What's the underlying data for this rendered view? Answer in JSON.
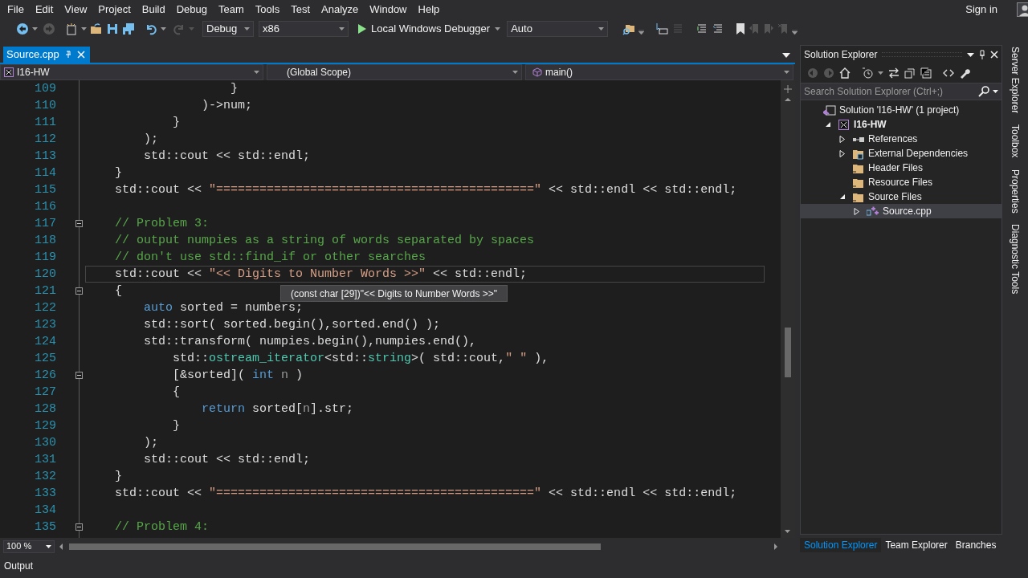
{
  "menu": [
    "File",
    "Edit",
    "View",
    "Project",
    "Build",
    "Debug",
    "Team",
    "Tools",
    "Test",
    "Analyze",
    "Window",
    "Help"
  ],
  "sign_in": "Sign in",
  "toolbar": {
    "configuration": "Debug",
    "platform": "x86",
    "debugger": "Local Windows Debugger",
    "option": "Auto"
  },
  "document_tabs": [
    {
      "title": "Source.cpp",
      "selected": true
    }
  ],
  "nav_bar": {
    "project": "I16-HW",
    "scope": "(Global Scope)",
    "member": "main()"
  },
  "editor": {
    "lines": [
      {
        "n": "109",
        "current": false,
        "fold": false,
        "tokens": [
          {
            "kind": "plain",
            "text": "                    }"
          }
        ]
      },
      {
        "n": "110",
        "current": false,
        "fold": false,
        "tokens": [
          {
            "kind": "plain",
            "text": "                )->num;"
          }
        ]
      },
      {
        "n": "111",
        "current": false,
        "fold": false,
        "tokens": [
          {
            "kind": "plain",
            "text": "            }"
          }
        ]
      },
      {
        "n": "112",
        "current": false,
        "fold": false,
        "tokens": [
          {
            "kind": "plain",
            "text": "        );"
          }
        ]
      },
      {
        "n": "113",
        "current": false,
        "fold": false,
        "tokens": [
          {
            "kind": "plain",
            "text": "        std::cout << std::endl;"
          }
        ]
      },
      {
        "n": "114",
        "current": false,
        "fold": false,
        "tokens": [
          {
            "kind": "plain",
            "text": "    }"
          }
        ]
      },
      {
        "n": "115",
        "current": false,
        "fold": false,
        "tokens": [
          {
            "kind": "plain",
            "text": "    std::cout << "
          },
          {
            "kind": "string",
            "text": "\"============================================\""
          },
          {
            "kind": "plain",
            "text": " << std::endl << std::endl;"
          }
        ]
      },
      {
        "n": "116",
        "current": false,
        "fold": false
      },
      {
        "n": "117",
        "current": false,
        "fold": true,
        "tokens": [
          {
            "kind": "comment",
            "text": "    // Problem 3:"
          }
        ]
      },
      {
        "n": "118",
        "current": false,
        "fold": false,
        "tokens": [
          {
            "kind": "comment",
            "text": "    // output numpies as a string of words separated by spaces"
          }
        ]
      },
      {
        "n": "119",
        "current": false,
        "fold": false,
        "tokens": [
          {
            "kind": "comment",
            "text": "    // don't use std::find_if or other searches"
          }
        ]
      },
      {
        "n": "120",
        "current": true,
        "fold": false,
        "tokens": [
          {
            "kind": "plain",
            "text": "    std::cout << "
          },
          {
            "kind": "string",
            "text": "\"<< Digits to Number Words >>\""
          },
          {
            "kind": "plain",
            "text": " << std::endl;"
          }
        ]
      },
      {
        "n": "121",
        "current": false,
        "fold": true,
        "tokens": [
          {
            "kind": "plain",
            "text": "    {"
          }
        ]
      },
      {
        "n": "122",
        "current": false,
        "fold": false,
        "tokens": [
          {
            "kind": "keyword",
            "text": "        auto"
          },
          {
            "kind": "plain",
            "text": " sorted = numbers;"
          }
        ]
      },
      {
        "n": "123",
        "current": false,
        "fold": false,
        "tokens": [
          {
            "kind": "plain",
            "text": "        std::sort( sorted.begin(),sorted.end() );"
          }
        ]
      },
      {
        "n": "124",
        "current": false,
        "fold": false,
        "tokens": [
          {
            "kind": "plain",
            "text": "        std::transform( numpies.begin(),numpies.end(),"
          }
        ]
      },
      {
        "n": "125",
        "current": false,
        "fold": false,
        "tokens": [
          {
            "kind": "plain",
            "text": "            std::"
          },
          {
            "kind": "type",
            "text": "ostream_iterator"
          },
          {
            "kind": "plain",
            "text": "<std::"
          },
          {
            "kind": "type",
            "text": "string"
          },
          {
            "kind": "plain",
            "text": ">( std::cout,"
          },
          {
            "kind": "string",
            "text": "\" \""
          },
          {
            "kind": "plain",
            "text": " ),"
          }
        ]
      },
      {
        "n": "126",
        "current": false,
        "fold": true,
        "tokens": [
          {
            "kind": "plain",
            "text": "            [&sorted]( "
          },
          {
            "kind": "keyword",
            "text": "int"
          },
          {
            "kind": "param",
            "text": " n"
          },
          {
            "kind": "plain",
            "text": " )"
          }
        ]
      },
      {
        "n": "127",
        "current": false,
        "fold": false,
        "tokens": [
          {
            "kind": "plain",
            "text": "            {"
          }
        ]
      },
      {
        "n": "128",
        "current": false,
        "fold": false,
        "tokens": [
          {
            "kind": "keyword",
            "text": "                return"
          },
          {
            "kind": "plain",
            "text": " sorted["
          },
          {
            "kind": "param",
            "text": "n"
          },
          {
            "kind": "plain",
            "text": "].str;"
          }
        ]
      },
      {
        "n": "129",
        "current": false,
        "fold": false,
        "tokens": [
          {
            "kind": "plain",
            "text": "            }"
          }
        ]
      },
      {
        "n": "130",
        "current": false,
        "fold": false,
        "tokens": [
          {
            "kind": "plain",
            "text": "        );"
          }
        ]
      },
      {
        "n": "131",
        "current": false,
        "fold": false,
        "tokens": [
          {
            "kind": "plain",
            "text": "        std::cout << std::endl;"
          }
        ]
      },
      {
        "n": "132",
        "current": false,
        "fold": false,
        "tokens": [
          {
            "kind": "plain",
            "text": "    }"
          }
        ]
      },
      {
        "n": "133",
        "current": false,
        "fold": false,
        "tokens": [
          {
            "kind": "plain",
            "text": "    std::cout << "
          },
          {
            "kind": "string",
            "text": "\"============================================\""
          },
          {
            "kind": "plain",
            "text": " << std::endl << std::endl;"
          }
        ]
      },
      {
        "n": "134",
        "current": false,
        "fold": false
      },
      {
        "n": "135",
        "current": false,
        "fold": true,
        "tokens": [
          {
            "kind": "comment",
            "text": "    // Problem 4:"
          }
        ]
      }
    ],
    "tooltip": "(const char [29])\"<< Digits to Number Words >>\"",
    "zoom": "100 %"
  },
  "solution_explorer": {
    "title": "Solution Explorer",
    "search": {
      "placeholder": "Search Solution Explorer (Ctrl+;)"
    },
    "tree": [
      {
        "label": "Solution 'I16-HW' (1 project)",
        "kind": "solution",
        "expandable": false,
        "selected": false,
        "children": [
          {
            "label": "I16-HW",
            "kind": "project",
            "expandable": true,
            "expanded": true,
            "selected": false,
            "children": [
              {
                "label": "References",
                "kind": "references",
                "expandable": true,
                "expanded": false,
                "selected": false
              },
              {
                "label": "External Dependencies",
                "kind": "external",
                "expandable": true,
                "expanded": false,
                "selected": false
              },
              {
                "label": "Header Files",
                "kind": "folder",
                "expandable": false,
                "selected": false
              },
              {
                "label": "Resource Files",
                "kind": "folder",
                "expandable": false,
                "selected": false
              },
              {
                "label": "Source Files",
                "kind": "folder",
                "expandable": true,
                "expanded": true,
                "selected": false,
                "children": [
                  {
                    "label": "Source.cpp",
                    "kind": "cpp",
                    "expandable": true,
                    "expanded": false,
                    "selected": true
                  }
                ]
              }
            ]
          }
        ]
      }
    ]
  },
  "panel_tabs": [
    {
      "label": "Solution Explorer",
      "selected": true
    },
    {
      "label": "Team Explorer",
      "selected": false
    },
    {
      "label": "Branches",
      "selected": false
    }
  ],
  "side_tabs": [
    "Server Explorer",
    "Toolbox",
    "Properties",
    "Diagnostic Tools"
  ],
  "output_tab": "Output"
}
